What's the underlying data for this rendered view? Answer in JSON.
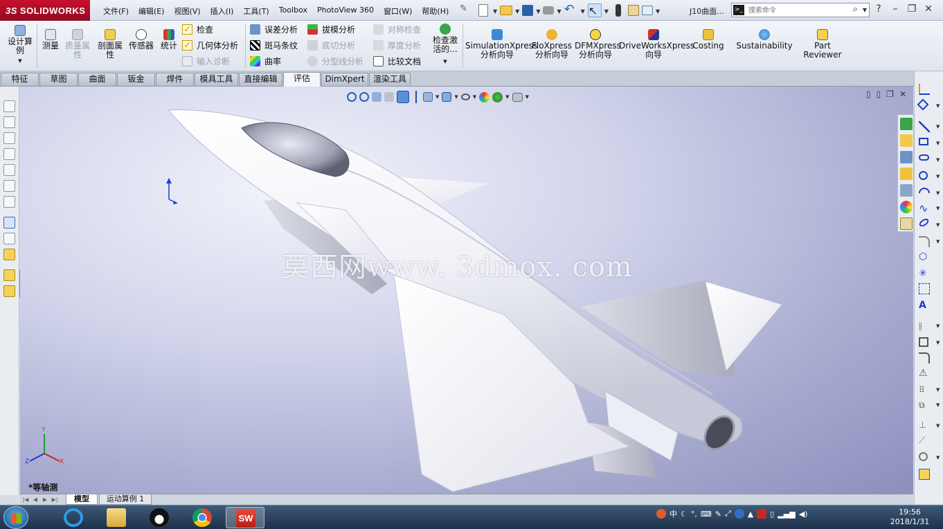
{
  "app": {
    "logo_prefix": "3S",
    "logo_text": "SOLIDWORKS",
    "document_title": "J10曲面..."
  },
  "menu": [
    "文件(F)",
    "编辑(E)",
    "视图(V)",
    "插入(I)",
    "工具(T)",
    "Toolbox",
    "PhotoView 360",
    "窗口(W)",
    "帮助(H)"
  ],
  "search": {
    "placeholder": "搜索命令"
  },
  "ribbon": {
    "design_study": "设计算例",
    "measure": "测量",
    "mass_properties": "质量属性",
    "section_properties": "剖面属性",
    "sensor": "传感器",
    "statistics": "统计",
    "check": "检查",
    "geometry_analysis": "几何体分析",
    "import_diagnostics": "输入诊断",
    "deviation_analysis": "误差分析",
    "zebra_stripes": "斑马条纹",
    "curvature": "曲率",
    "draft_analysis": "拔模分析",
    "undercut_analysis": "底切分析",
    "parting_line_analysis": "分型线分析",
    "symmetry_check": "对称检查",
    "thickness_analysis": "厚度分析",
    "compare_documents": "比较文档",
    "check_active": "检查激活的...",
    "simulation_xpress": "SimulationXpress 分析向导",
    "flo_xpress": "FloXpress 分析向导",
    "dfm_xpress": "DFMXpress 分析向导",
    "driveworks_xpress": "DriveWorksXpress 向导",
    "costing": "Costing",
    "sustainability": "Sustainability",
    "part_reviewer": "Part Reviewer"
  },
  "tabs": [
    "特征",
    "草图",
    "曲面",
    "钣金",
    "焊件",
    "模具工具",
    "直接编辑",
    "评估",
    "DimXpert",
    "渲染工具"
  ],
  "active_tab": "评估",
  "viewport": {
    "watermark": "莫西网www. 3dmox. com",
    "view_label": "*等轴测"
  },
  "triad": {
    "x": "X",
    "y": "Y",
    "z": "Z"
  },
  "sheets": [
    "模型",
    "运动算例 1"
  ],
  "taskbar": {
    "time": "19:56",
    "date": "2018/1/31",
    "ime": "中",
    "sw_label": "SW"
  },
  "colors": {
    "accent": "#c8102e",
    "viewport_top": "#f2f3fb",
    "viewport_bottom": "#8c8fbd",
    "taskbar": "#1d3149"
  }
}
